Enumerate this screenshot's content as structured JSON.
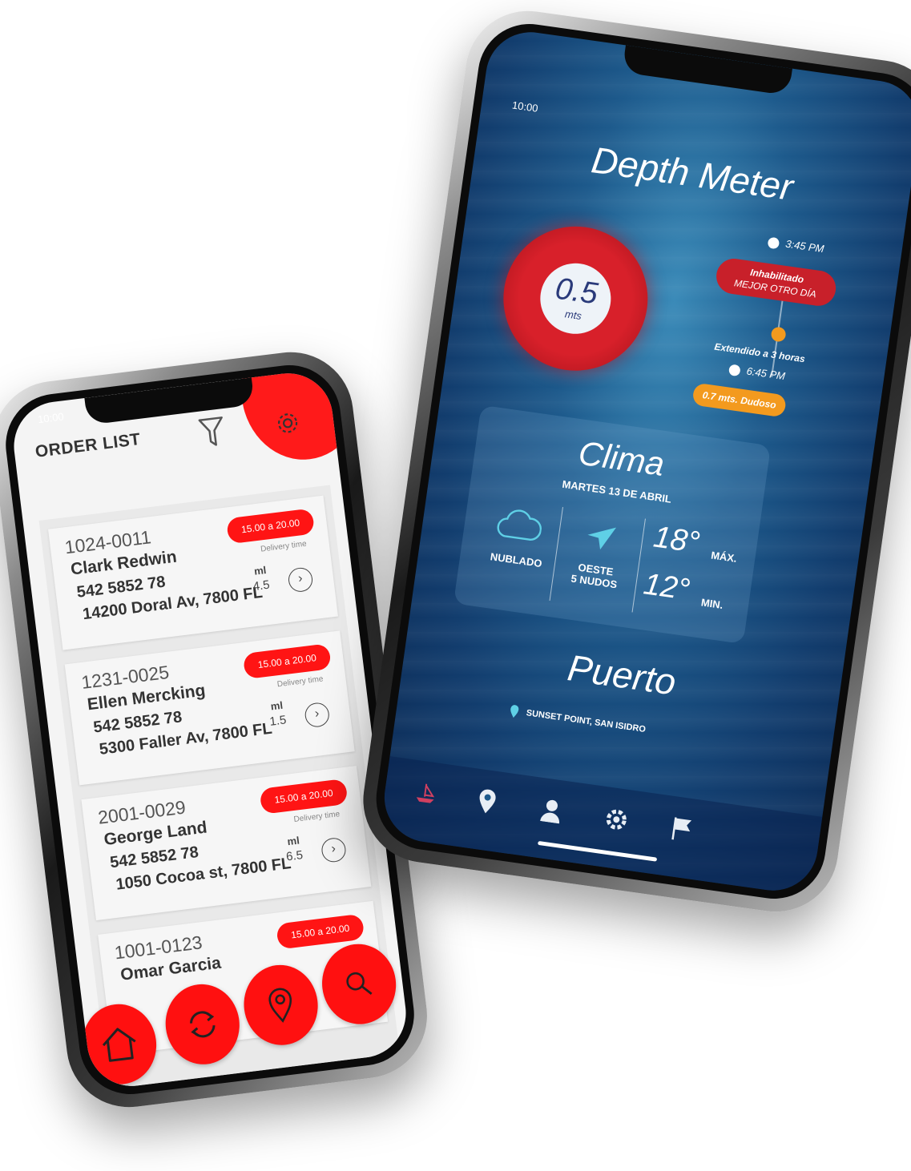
{
  "order_app": {
    "status_time": "10:00",
    "title": "ORDER LIST",
    "orders": [
      {
        "id": "1024-0011",
        "name": "Clark Redwin",
        "phone": "542 5852 78",
        "address": "14200 Doral Av, 7800 FL",
        "time_window": "15.00 a 20.00",
        "time_label": "Delivery time",
        "qty_label": "ml",
        "qty": "4.5"
      },
      {
        "id": "1231-0025",
        "name": "Ellen Mercking",
        "phone": "542 5852 78",
        "address": "5300 Faller Av, 7800 FL",
        "time_window": "15.00 a 20.00",
        "time_label": "Delivery time",
        "qty_label": "ml",
        "qty": "1.5"
      },
      {
        "id": "2001-0029",
        "name": "George Land",
        "phone": "542 5852 78",
        "address": "1050 Cocoa st, 7800 FL",
        "time_window": "15.00 a 20.00",
        "time_label": "Delivery time",
        "qty_label": "ml",
        "qty": "6.5"
      },
      {
        "id": "1001-0123",
        "name": "Omar Garcia",
        "time_window": "15.00 a 20.00"
      }
    ],
    "accent": "#ff1414",
    "nav_icons": [
      "home-icon",
      "refresh-icon",
      "map-pin-icon",
      "search-icon"
    ]
  },
  "depth_app": {
    "status_time": "10:00",
    "title": "Depth Meter",
    "gauge_value": "0.5",
    "gauge_unit": "mts",
    "timeline": {
      "time1": "3:45 PM",
      "status_line1": "Inhabilitado",
      "status_line2": "MEJOR OTRO DÍA",
      "extended": "Extendido a 3 horas",
      "time2": "6:45 PM",
      "forecast": "0.7 mts. Dudoso"
    },
    "clima": {
      "title": "Clima",
      "date": "MARTES 13 DE ABRIL",
      "sky": "NUBLADO",
      "wind_dir": "OESTE",
      "wind_speed": "5 NUDOS",
      "max_temp": "18°",
      "max_label": "MÁX.",
      "min_temp": "12°",
      "min_label": "MIN."
    },
    "port": {
      "title": "Puerto",
      "location": "SUNSET POINT, SAN ISIDRO"
    },
    "colors": {
      "danger": "#c8202a",
      "warning": "#f39a1e",
      "ocean": "#1d5a8c"
    },
    "nav_icons": [
      "boat-icon",
      "map-pin-icon",
      "user-icon",
      "gear-icon",
      "flag-icon"
    ]
  }
}
